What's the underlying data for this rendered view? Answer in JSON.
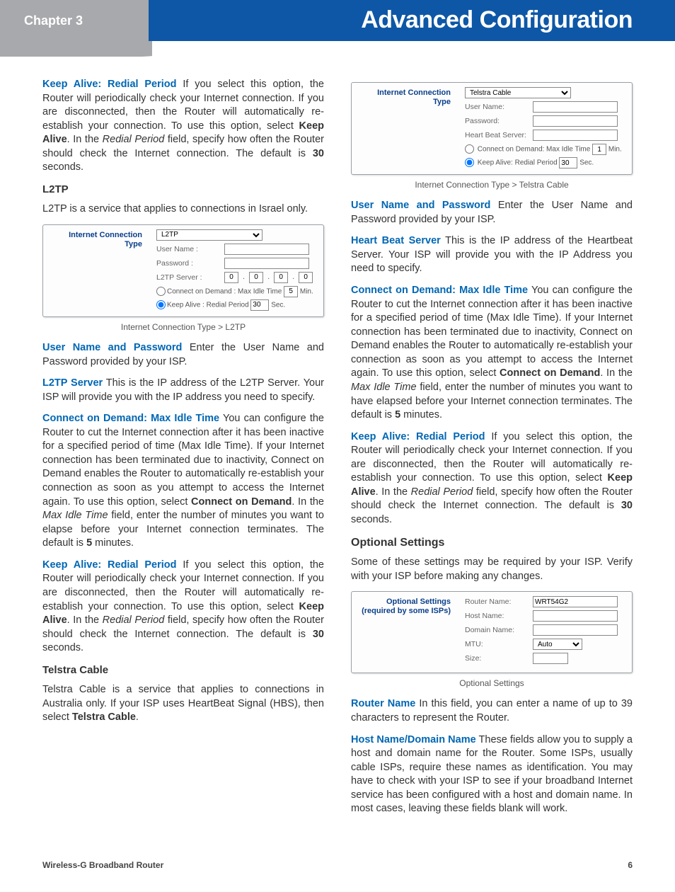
{
  "header": {
    "chapter": "Chapter 3",
    "title": "Advanced Configuration"
  },
  "footer": {
    "product": "Wireless-G Broadband Router",
    "page": "6"
  },
  "col1": {
    "p_keep_alive_1": {
      "lead": "Keep Alive: Redial Period",
      "body": "  If you select this option, the Router will periodically check your Internet connection. If you are disconnected, then the Router will automatically re-establish your connection. To use this option, select ",
      "b1": "Keep Alive",
      "body2": ". In the ",
      "i1": "Redial Period",
      "body3": " field, specify how often the Router should check the Internet connection. The default is ",
      "b2": "30",
      "body4": " seconds."
    },
    "h_l2tp": "L2TP",
    "p_l2tp_intro": "L2TP is a service that applies to connections in Israel only.",
    "shot_l2tp": {
      "left": "Internet Connection Type",
      "conn_type": "L2TP",
      "user": "User Name :",
      "pass": "Password :",
      "server": "L2TP Server :",
      "ip": [
        "0",
        "0",
        "0",
        "0"
      ],
      "cod": "Connect on Demand : Max Idle Time",
      "cod_val": "5",
      "cod_unit": "Min.",
      "ka": "Keep Alive : Redial Period",
      "ka_val": "30",
      "ka_unit": "Sec."
    },
    "cap_l2tp": "Internet Connection Type > L2TP",
    "p_userpass_1": {
      "lead": "User Name and Password",
      "body": "  Enter the User Name and Password provided by your ISP."
    },
    "p_l2tp_server": {
      "lead": "L2TP Server",
      "body": "  This is the IP address of the L2TP Server. Your ISP will provide you with the IP address you need to specify."
    },
    "p_cod_1": {
      "lead": "Connect on Demand: Max Idle Time",
      "body": "  You can configure the Router to cut the Internet connection after it has been inactive for a specified period of time (Max Idle Time). If your Internet connection has been terminated due to inactivity, Connect on Demand enables the Router to automatically re-establish your connection as soon as you attempt to access the Internet again. To use this option, select ",
      "b1": "Connect on Demand",
      "body2": ". In the ",
      "i1": "Max Idle Time",
      "body3": " field, enter the number of minutes you want to elapse before your Internet connection terminates. The default is ",
      "b2": "5",
      "body4": " minutes."
    },
    "p_keep_alive_2": {
      "lead": "Keep Alive: Redial Period",
      "body": "  If you select this option, the Router will periodically check your Internet connection. If you are disconnected, then the Router will automatically re-establish your connection. To use this option, select ",
      "b1": "Keep Alive",
      "body2": ". In the ",
      "i1": "Redial Period",
      "body3": " field, specify how often the Router should check the Internet connection. The default is ",
      "b2": "30",
      "body4": " seconds."
    },
    "h_telstra": "Telstra Cable",
    "p_telstra_intro": {
      "body": "Telstra Cable is a service that applies to connections in Australia only. If your ISP uses HeartBeat Signal (HBS), then select ",
      "b1": "Telstra Cable",
      "body2": "."
    }
  },
  "col2": {
    "shot_telstra": {
      "left": "Internet Connection Type",
      "conn_type": "Telstra Cable",
      "user": "User Name:",
      "pass": "Password:",
      "hbs": "Heart Beat Server:",
      "cod": "Connect on Demand: Max Idle Time",
      "cod_val": "1",
      "cod_unit": "Min.",
      "ka": "Keep Alive: Redial Period",
      "ka_val": "30",
      "ka_unit": "Sec."
    },
    "cap_telstra": "Internet Connection Type > Telstra Cable",
    "p_userpass_2": {
      "lead": "User Name and Password",
      "body": "  Enter the User Name and Password provided by your ISP."
    },
    "p_hbs": {
      "lead": "Heart Beat Server",
      "body": "  This is the IP address of the Heartbeat Server. Your ISP will provide you with the IP Address you need to specify."
    },
    "p_cod_2": {
      "lead": "Connect on Demand: Max Idle Time",
      "body": "  You can configure the Router to cut the Internet connection after it has been inactive for a specified period of time (Max Idle Time). If your Internet connection has been terminated due to inactivity, Connect on Demand enables the Router to automatically re-establish your connection as soon as you attempt to access the Internet again. To use this option, select ",
      "b1": "Connect on Demand",
      "body2": ". In the ",
      "i1": "Max Idle Time",
      "body3": " field, enter the number of minutes you want to have elapsed before your Internet connection terminates. The default is ",
      "b2": "5",
      "body4": " minutes."
    },
    "p_keep_alive_3": {
      "lead": "Keep Alive: Redial Period",
      "body": "  If you select this option, the Router will periodically check your Internet connection. If you are disconnected, then the Router will automatically re-establish your connection. To use this option, select ",
      "b1": "Keep Alive",
      "body2": ". In the ",
      "i1": "Redial Period",
      "body3": " field, specify how often the Router should check the Internet connection. The default is ",
      "b2": "30",
      "body4": " seconds."
    },
    "h_optional": "Optional Settings",
    "p_optional_intro": "Some of these settings may be required by your ISP. Verify with your ISP before making any changes.",
    "shot_optional": {
      "left1": "Optional Settings",
      "left2": "(required by some ISPs)",
      "router": "Router Name:",
      "router_val": "WRT54G2",
      "host": "Host Name:",
      "domain": "Domain Name:",
      "mtu": "MTU:",
      "mtu_val": "Auto",
      "size": "Size:"
    },
    "cap_optional": "Optional Settings",
    "p_router_name": {
      "lead": "Router Name",
      "body": "  In this field, you can enter a name of up to 39 characters to represent the Router."
    },
    "p_host_domain": {
      "lead": "Host Name/Domain Name",
      "body": "  These fields allow you to supply a host and domain name for the Router. Some ISPs, usually cable ISPs, require these names as identification. You may have to check with your ISP to see if your broadband Internet service has been configured with a host and domain name. In most cases, leaving these fields blank will work."
    }
  }
}
